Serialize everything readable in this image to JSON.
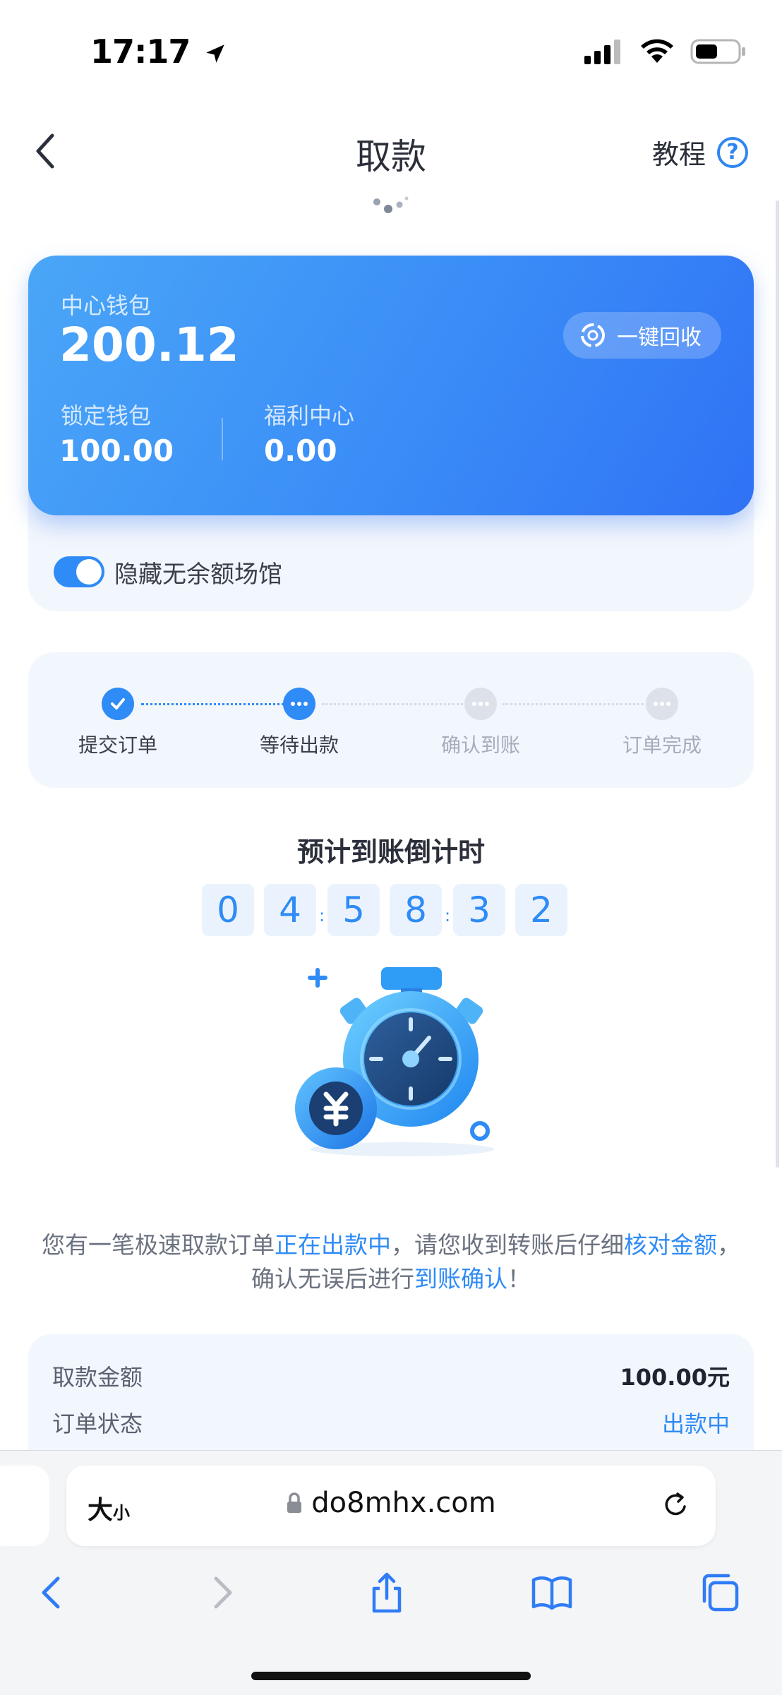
{
  "status": {
    "time": "17:17"
  },
  "header": {
    "title": "取款",
    "tutorial_label": "教程",
    "help_symbol": "?"
  },
  "wallet": {
    "center_label": "中心钱包",
    "center_value": "200.12",
    "recycle_label": "一键回收",
    "locked_label": "锁定钱包",
    "locked_value": "100.00",
    "welfare_label": "福利中心",
    "welfare_value": "0.00",
    "hide_toggle_label": "隐藏无余额场馆",
    "hide_toggle_on": true
  },
  "steps": [
    {
      "label": "提交订单",
      "state": "done"
    },
    {
      "label": "等待出款",
      "state": "current"
    },
    {
      "label": "确认到账",
      "state": "pending"
    },
    {
      "label": "订单完成",
      "state": "pending"
    }
  ],
  "countdown": {
    "title": "预计到账倒计时",
    "digits": [
      "0",
      "4",
      "5",
      "8",
      "3",
      "2"
    ],
    "separator": ":"
  },
  "notice": {
    "p1": "您有一笔极速取款订单",
    "h1": "正在出款中",
    "p2": "，请您收到转账后仔细",
    "h2": "核对金额",
    "p3": "，",
    "p4": "确认无误后进行",
    "h3": "到账确认",
    "p5": "！"
  },
  "details": {
    "amount_label": "取款金额",
    "amount_value": "100.00元",
    "status_label": "订单状态",
    "status_value": "出款中"
  },
  "browser": {
    "text_size_label": "大",
    "text_size_small": "小",
    "url": "do8mhx.com"
  },
  "colors": {
    "accent": "#2f8bf5",
    "wallet_gradient_start": "#4aa6f7",
    "wallet_gradient_end": "#2f72f5"
  }
}
